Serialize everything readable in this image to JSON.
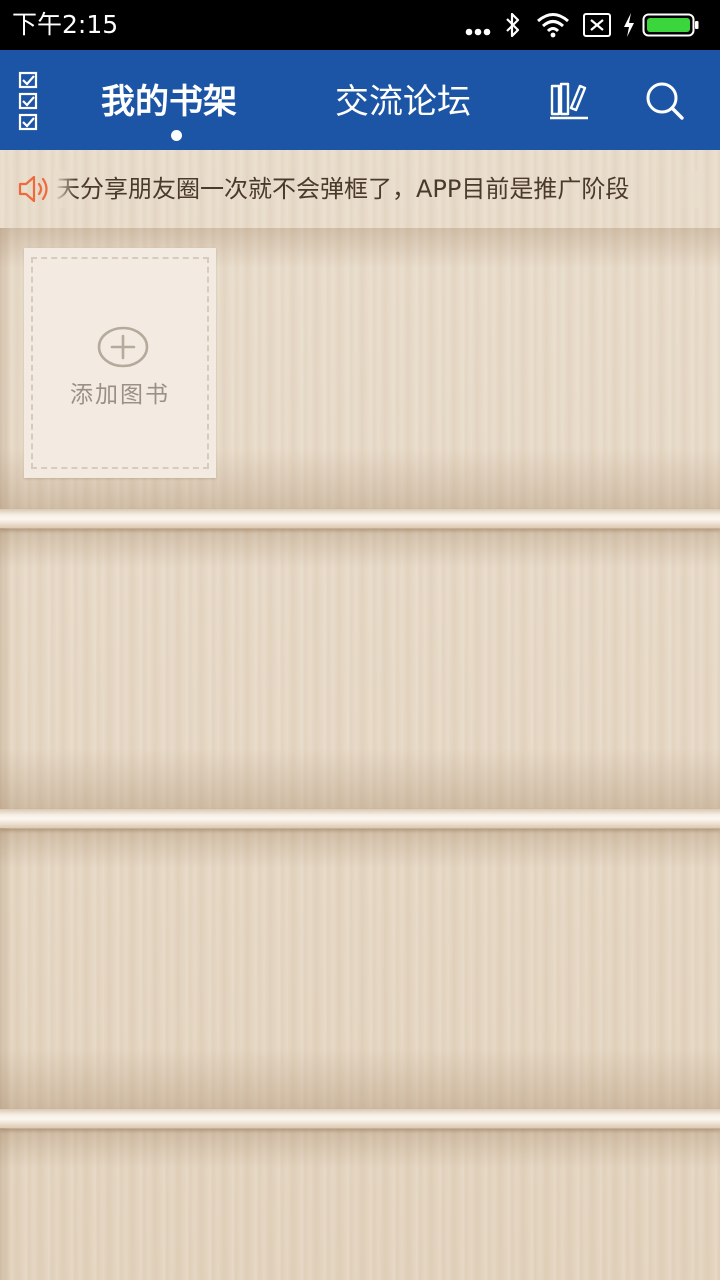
{
  "status_bar": {
    "time": "下午2:15",
    "icons": [
      "more-dots-icon",
      "bluetooth-icon",
      "wifi-icon",
      "no-sim-icon",
      "charging-icon",
      "battery-icon"
    ],
    "battery_color": "#3bd63b"
  },
  "header": {
    "background": "#1d55a6",
    "tabs": [
      {
        "label": "我的书架",
        "active": true
      },
      {
        "label": "交流论坛",
        "active": false
      }
    ],
    "icons": [
      "checklist-icon",
      "library-icon",
      "search-icon"
    ]
  },
  "notice": {
    "icon": "speaker-icon",
    "icon_color": "#ee6a3c",
    "text": "天分享朋友圈一次就不会弹框了，APP目前是推广阶段"
  },
  "bookshelf": {
    "add_book_label": "添加图书",
    "add_icon": "plus-circle-icon"
  }
}
